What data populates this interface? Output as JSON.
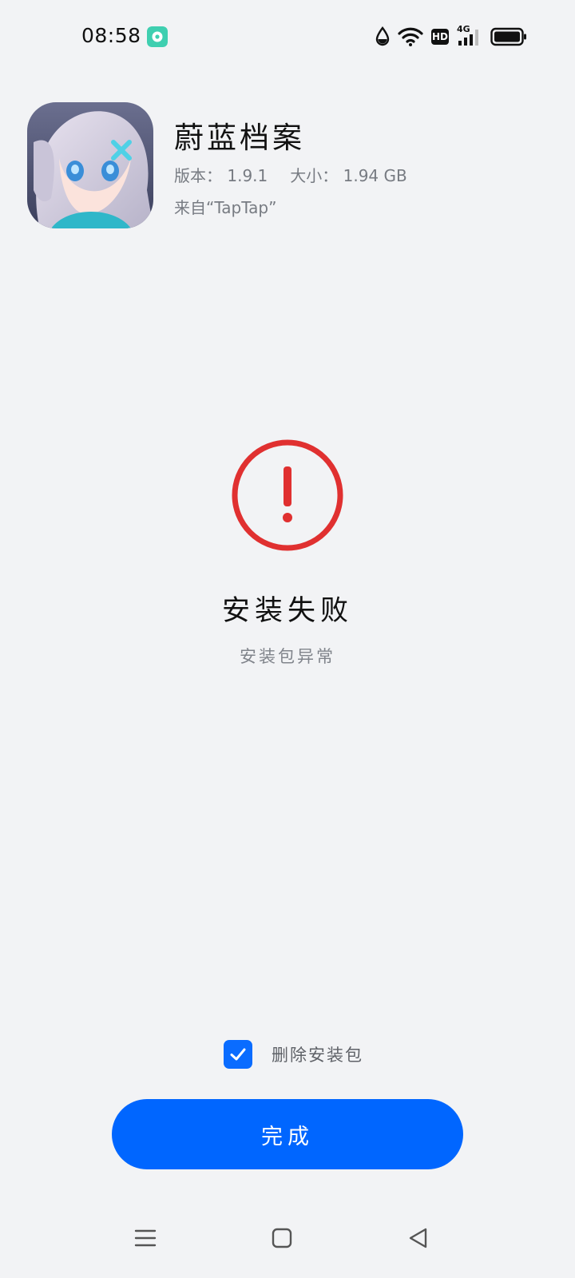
{
  "status_bar": {
    "time": "08:58",
    "notification_icon": "chat-bubble-app-icon",
    "icons": [
      "water-drop-icon",
      "wifi-icon",
      "hd-icon",
      "4g-signal-icon",
      "battery-icon"
    ],
    "network_label": "4G",
    "hd_label": "HD"
  },
  "app": {
    "name": "蔚蓝档案",
    "version_label": "版本：",
    "version": "1.9.1",
    "size_label": "大小：",
    "size": "1.94 GB",
    "source": "来自“TapTap”"
  },
  "result": {
    "icon": "error-exclamation-icon",
    "title": "安装失败",
    "subtitle": "安装包异常"
  },
  "delete_package": {
    "checked": true,
    "label": "删除安装包"
  },
  "done_button": {
    "label": "完成"
  },
  "nav_bar": {
    "icons": [
      "menu-icon",
      "home-square-icon",
      "back-triangle-icon"
    ]
  },
  "colors": {
    "background": "#f2f3f5",
    "accent": "#0066ff",
    "error": "#e03030"
  }
}
